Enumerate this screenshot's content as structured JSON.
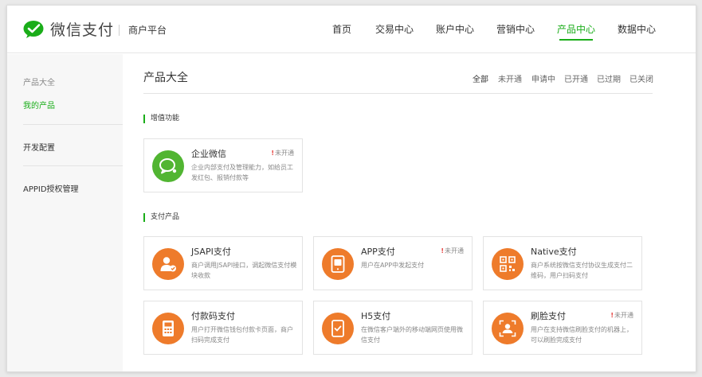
{
  "brand": {
    "name": "微信支付",
    "sub": "商户平台"
  },
  "nav": [
    "首页",
    "交易中心",
    "账户中心",
    "营销中心",
    "产品中心",
    "数据中心"
  ],
  "sidebar": {
    "items": [
      "产品大全",
      "我的产品",
      "开发配置",
      "APPID授权管理"
    ]
  },
  "page": {
    "title": "产品大全",
    "filters": [
      "全部",
      "未开通",
      "申请中",
      "已开通",
      "已过期",
      "已关闭"
    ]
  },
  "sections": [
    {
      "title": "增值功能",
      "cards": [
        {
          "title": "企业微信",
          "desc": "企业内部支付及管理能力，如给员工发红包、报销付款等",
          "status": "未开通",
          "icon": "wechat-work-icon",
          "color": "#51b532"
        }
      ]
    },
    {
      "title": "支付产品",
      "cards": [
        {
          "title": "JSAPI支付",
          "desc": "商户调用JSAPI接口，调起微信支付模块收款",
          "status": "",
          "icon": "user-check-icon",
          "color": "#ee7b2b"
        },
        {
          "title": "APP支付",
          "desc": "用户在APP中发起支付",
          "status": "未开通",
          "icon": "mobile-app-icon",
          "color": "#ee7b2b"
        },
        {
          "title": "Native支付",
          "desc": "商户系统按微信支付协议生成支付二维码，用户扫码支付",
          "status": "",
          "icon": "qr-code-icon",
          "color": "#ee7b2b"
        },
        {
          "title": "付款码支付",
          "desc": "用户打开微信钱包付款卡页面，商户扫码完成支付",
          "status": "",
          "icon": "pos-terminal-icon",
          "color": "#ee7b2b"
        },
        {
          "title": "H5支付",
          "desc": "在微信客户端外的移动端网页使用微信支付",
          "status": "",
          "icon": "mobile-check-icon",
          "color": "#ee7b2b"
        },
        {
          "title": "刷脸支付",
          "desc": "用户在支持微信刷脸支付的机器上，可以刷脸完成支付",
          "status": "未开通",
          "icon": "face-scan-icon",
          "color": "#ee7b2b"
        }
      ]
    }
  ]
}
